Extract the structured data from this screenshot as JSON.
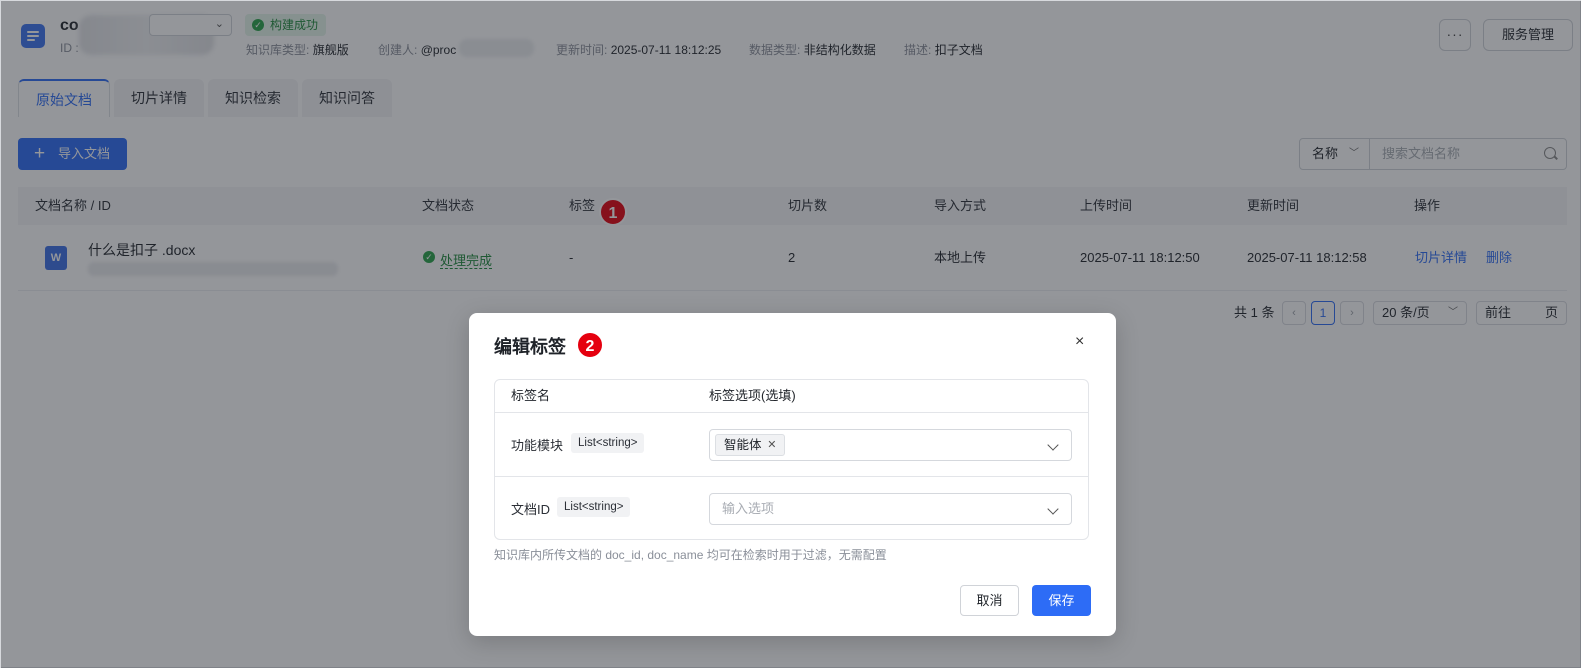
{
  "header": {
    "kb_name": "co",
    "id_label": "ID :",
    "build_status": "构建成功",
    "kb_type_label": "知识库类型:",
    "kb_type_value": "旗舰版",
    "creator_label": "创建人:",
    "creator_value": "@proc",
    "updated_label": "更新时间:",
    "updated_value": "2025-07-11 18:12:25",
    "data_type_label": "数据类型:",
    "data_type_value": "非结构化数据",
    "desc_label": "描述:",
    "desc_value": "扣子文档",
    "more_label": "···",
    "service_button": "服务管理"
  },
  "tabs": [
    {
      "label": "原始文档",
      "active": true
    },
    {
      "label": "切片详情",
      "active": false
    },
    {
      "label": "知识检索",
      "active": false
    },
    {
      "label": "知识问答",
      "active": false
    }
  ],
  "toolbar": {
    "import_label": "导入文档",
    "search_field": "名称",
    "search_placeholder": "搜索文档名称"
  },
  "table": {
    "columns": [
      "文档名称 / ID",
      "文档状态",
      "标签",
      "切片数",
      "导入方式",
      "上传时间",
      "更新时间",
      "操作"
    ],
    "rows": [
      {
        "name": "什么是扣子 .docx",
        "status": "处理完成",
        "tags": "-",
        "slices": "2",
        "import_method": "本地上传",
        "uploaded": "2025-07-11 18:12:50",
        "updated": "2025-07-11 18:12:58",
        "action_detail": "切片详情",
        "action_delete": "删除"
      }
    ]
  },
  "pagination": {
    "total": "共 1 条",
    "current": "1",
    "page_size": "20 条/页",
    "goto_prefix": "前往",
    "goto_suffix": "页"
  },
  "callouts": [
    "1",
    "2"
  ],
  "modal": {
    "title": "编辑标签",
    "close": "×",
    "col_name": "标签名",
    "col_options": "标签选项(选填)",
    "rows": [
      {
        "name": "功能模块",
        "type": "List<string>",
        "selected": "智能体",
        "placeholder": ""
      },
      {
        "name": "文档ID",
        "type": "List<string>",
        "selected": "",
        "placeholder": "输入选项"
      }
    ],
    "hint": "知识库内所传文档的 doc_id, doc_name 均可在检索时用于过滤，无需配置",
    "cancel": "取消",
    "save": "保存"
  },
  "colors": {
    "primary": "#2d6cf6",
    "success": "#2aa34a",
    "callout": "#e5000f"
  }
}
